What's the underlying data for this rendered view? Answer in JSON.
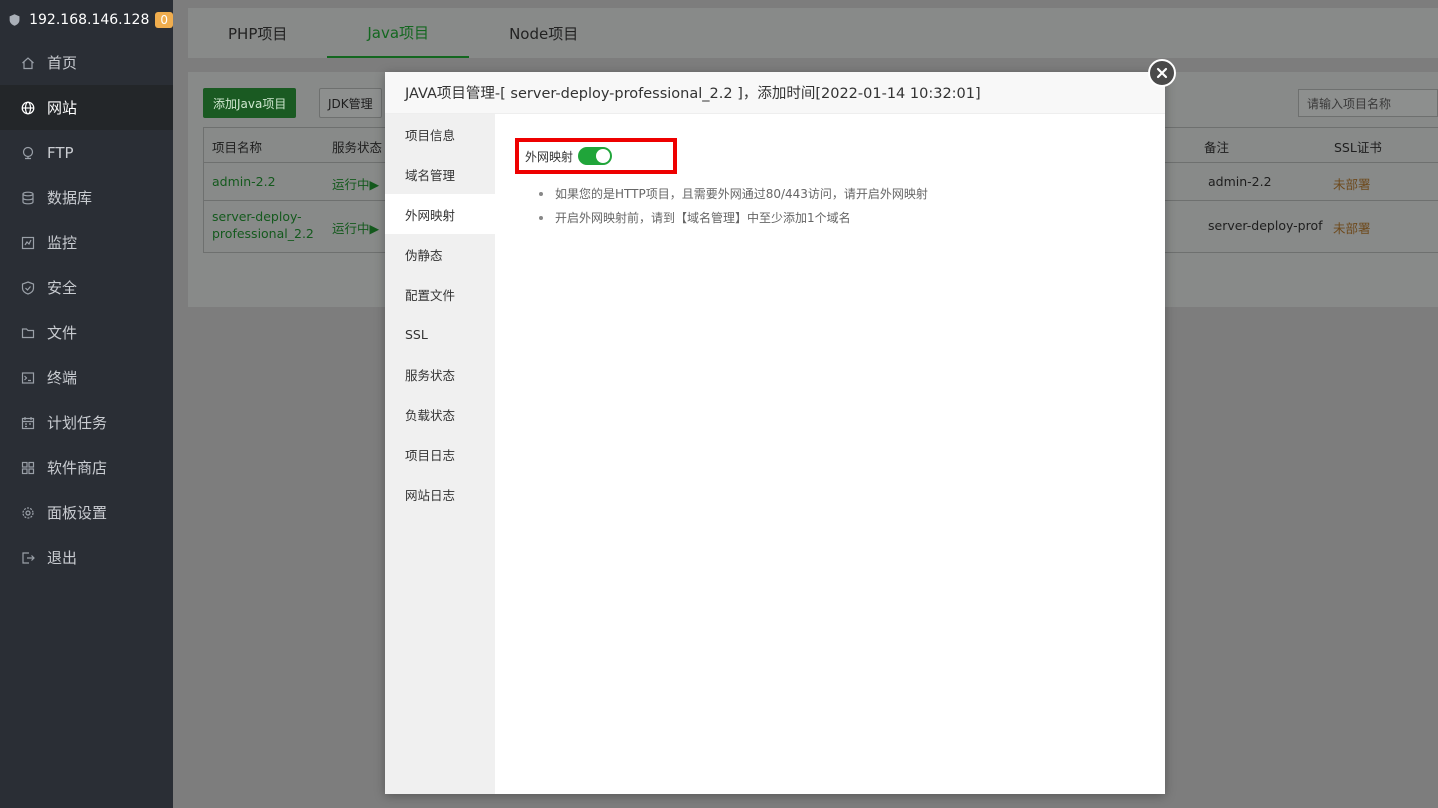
{
  "header": {
    "ip": "192.168.146.128",
    "badge": "0"
  },
  "sidebar": {
    "items": [
      {
        "label": "首页",
        "icon": "home-icon"
      },
      {
        "label": "网站",
        "icon": "globe-icon",
        "active": true
      },
      {
        "label": "FTP",
        "icon": "ftp-icon"
      },
      {
        "label": "数据库",
        "icon": "database-icon"
      },
      {
        "label": "监控",
        "icon": "monitor-icon"
      },
      {
        "label": "安全",
        "icon": "shield-icon"
      },
      {
        "label": "文件",
        "icon": "folder-icon"
      },
      {
        "label": "终端",
        "icon": "terminal-icon"
      },
      {
        "label": "计划任务",
        "icon": "calendar-icon"
      },
      {
        "label": "软件商店",
        "icon": "apps-icon"
      },
      {
        "label": "面板设置",
        "icon": "gear-icon"
      },
      {
        "label": "退出",
        "icon": "logout-icon"
      }
    ]
  },
  "tabs": [
    "PHP项目",
    "Java项目",
    "Node项目"
  ],
  "toolbar": {
    "add_label": "添加Java项目",
    "jdk_label": "JDK管理",
    "search_placeholder": "请输入项目名称"
  },
  "table": {
    "headers": {
      "name": "项目名称",
      "status": "服务状态",
      "remark": "备注",
      "ssl": "SSL证书"
    },
    "rows": [
      {
        "name": "admin-2.2",
        "status": "运行中▶",
        "remark": "admin-2.2",
        "ssl": "未部署"
      },
      {
        "name_line1": "server-deploy-",
        "name_line2": "professional_2.2",
        "status": "运行中▶",
        "remark": "server-deploy-prof",
        "ssl": "未部署"
      }
    ]
  },
  "modal": {
    "title": "JAVA项目管理-[ server-deploy-professional_2.2 ]，添加时间[2022-01-14 10:32:01]",
    "nav": [
      "项目信息",
      "域名管理",
      "外网映射",
      "伪静态",
      "配置文件",
      "SSL",
      "服务状态",
      "负载状态",
      "项目日志",
      "网站日志"
    ],
    "active_nav": "外网映射",
    "mapping_label": "外网映射",
    "mapping_enabled": true,
    "tips": [
      "如果您的是HTTP项目，且需要外网通过80/443访问，请开启外网映射",
      "开启外网映射前，请到【域名管理】中至少添加1个域名"
    ]
  },
  "colors": {
    "accent": "#20a53a",
    "highlight": "#ee0000",
    "sidebar": "#2a2e35"
  }
}
